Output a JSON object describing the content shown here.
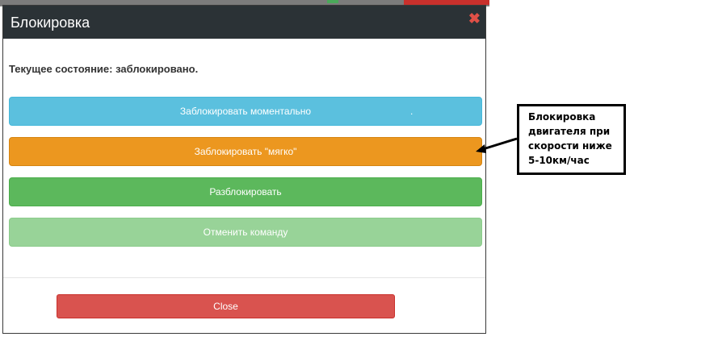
{
  "modal": {
    "title": "Блокировка",
    "close_symbol": "✖",
    "status_text": "Текущее состояние: заблокировано.",
    "buttons": {
      "lock_instant": "Заблокировать моментально",
      "lock_soft": "Заблокировать \"мягко\"",
      "unlock": "Разблокировать",
      "cancel_command": "Отменить команду",
      "close": "Close"
    },
    "lock_instant_dot": "."
  },
  "callout": {
    "line1": "Блокировка",
    "line2": "двигателя при",
    "line3": "скорости ниже",
    "line4": "5-10км/час"
  },
  "colors": {
    "header": "#2b3236",
    "info": "#5bc0de",
    "warning": "#ec971f",
    "success": "#5cb85c",
    "disabled_success": "#98d398",
    "danger": "#d9534f",
    "close_icon": "#e05047"
  },
  "icons": {
    "close": "close-icon"
  }
}
